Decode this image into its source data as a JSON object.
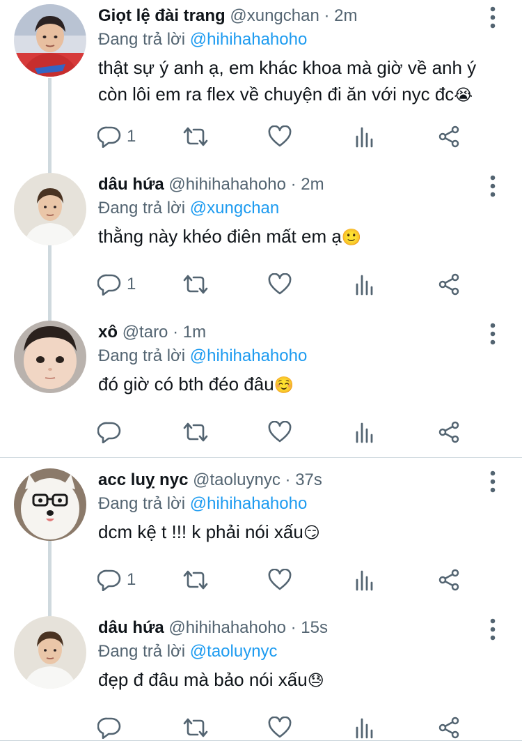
{
  "replying_prefix": "Đang trả lời",
  "tweets": [
    {
      "name": "Giọt lệ đài trang",
      "handle": "@xungchan",
      "time": "2m",
      "reply_to": "@hihihahahoho",
      "text": "thật sự ý anh ạ, em khác khoa mà giờ về anh ý còn lôi em ra flex về chuyện đi ăn với nyc đc",
      "emoji": "😭",
      "reply_count": "1",
      "avatar": "boy-red-jacket"
    },
    {
      "name": "dâu hứa",
      "handle": "@hihihahahoho",
      "time": "2m",
      "reply_to": "@xungchan",
      "text": "thằng này khéo điên mất em ạ",
      "emoji": "🙂",
      "reply_count": "1",
      "avatar": "young-man-white-shirt"
    },
    {
      "name": "xô",
      "handle": "@taro",
      "time": "1m",
      "reply_to": "@hihihahahoho",
      "text": "đó giờ có bth đéo đâu",
      "emoji": "☺️",
      "reply_count": "",
      "avatar": "baby-face"
    },
    {
      "name": "acc luỵ nyc",
      "handle": "@taoluynyc",
      "time": "37s",
      "reply_to": "@hihihahahoho",
      "text": "dcm kệ t !!! k phải nói xấu",
      "emoji": "😏",
      "reply_count": "1",
      "avatar": "white-dog-glasses"
    },
    {
      "name": "dâu hứa",
      "handle": "@hihihahahoho",
      "time": "15s",
      "reply_to": "@taoluynyc",
      "text": "đẹp đ đâu mà bảo nói xấu",
      "emoji": "😓",
      "reply_count": "",
      "avatar": "young-man-white-shirt"
    }
  ],
  "icons": {
    "more": "more-vertical-icon",
    "reply": "reply-icon",
    "retweet": "retweet-icon",
    "like": "heart-icon",
    "views": "views-bar-chart-icon",
    "share": "share-icon"
  },
  "colors": {
    "text": "#0f1419",
    "secondary": "#536471",
    "mention": "#1d9bf0",
    "thread_line": "#cfd9de"
  }
}
